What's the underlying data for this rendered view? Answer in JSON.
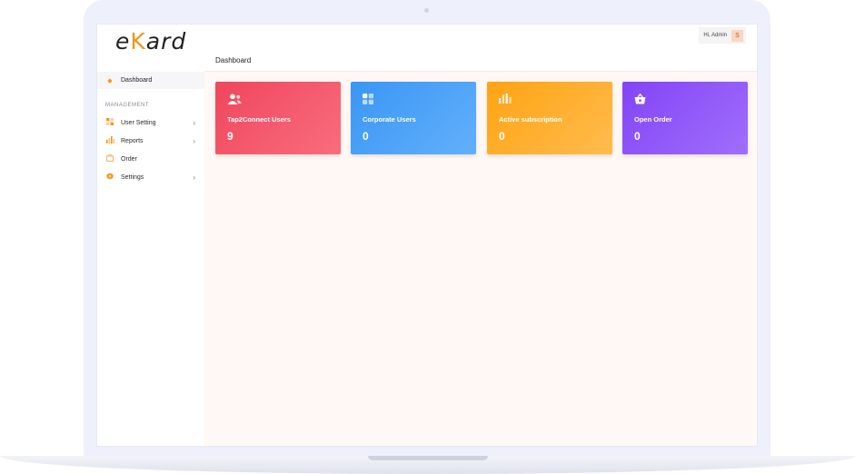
{
  "brand": {
    "logo_left": "e",
    "logo_mid": "K",
    "logo_right": "ard"
  },
  "header": {
    "greeting": "Hi, Admin",
    "avatar_initial": "S"
  },
  "page": {
    "title": "Dashboard"
  },
  "sidebar": {
    "active_item": "Dashboard",
    "section_label": "MANAGEMENT",
    "items": [
      {
        "label": "User Setting",
        "icon": "user-setting-icon",
        "has_chevron": true
      },
      {
        "label": "Reports",
        "icon": "reports-icon",
        "has_chevron": true
      },
      {
        "label": "Order",
        "icon": "order-icon",
        "has_chevron": false
      },
      {
        "label": "Settings",
        "icon": "settings-icon",
        "has_chevron": true
      }
    ],
    "chevron": "›"
  },
  "cards": [
    {
      "label": "Tap2Connect Users",
      "value": "9",
      "icon": "users-icon",
      "color": "#f04b5f"
    },
    {
      "label": "Corporate Users",
      "value": "0",
      "icon": "grid-icon",
      "color": "#3d9bf5"
    },
    {
      "label": "Active subscription",
      "value": "0",
      "icon": "bar-chart-icon",
      "color": "#ffa51f"
    },
    {
      "label": "Open Order",
      "value": "0",
      "icon": "basket-icon",
      "color": "#8a49f7"
    }
  ],
  "colors": {
    "accent": "#f7941d",
    "content_bg": "#fff8f4"
  }
}
